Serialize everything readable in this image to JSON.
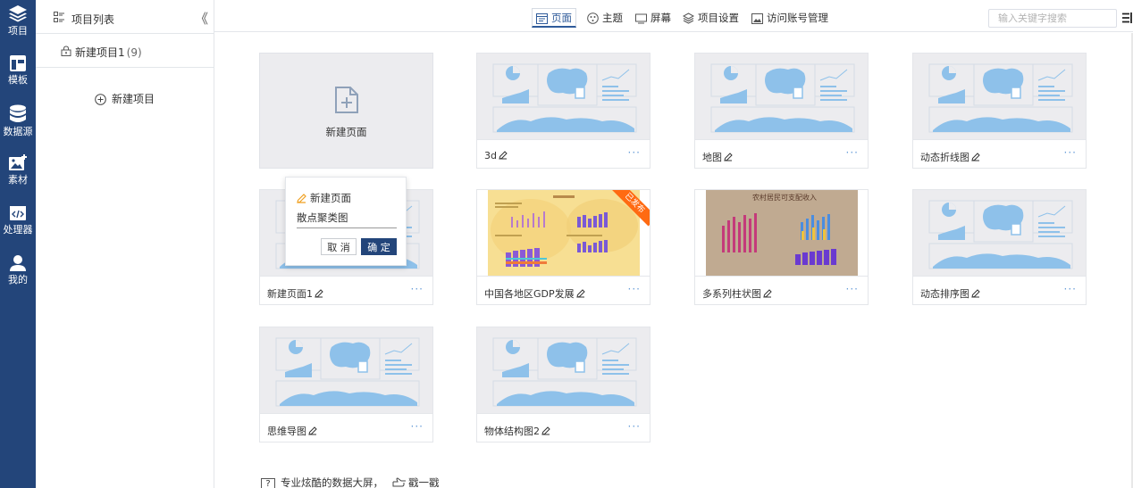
{
  "rail": {
    "items": [
      {
        "label": "项目",
        "icon": "layers-icon"
      },
      {
        "label": "模板",
        "icon": "template-icon"
      },
      {
        "label": "数据源",
        "icon": "database-icon"
      },
      {
        "label": "素材",
        "icon": "image-add-icon"
      },
      {
        "label": "处理器",
        "icon": "code-icon"
      },
      {
        "label": "我的",
        "icon": "user-icon"
      }
    ]
  },
  "panel": {
    "title": "项目列表",
    "collapse": "《",
    "project_name": "新建项目1",
    "project_count": "(9)",
    "new_project": "新建项目"
  },
  "topbar": {
    "tabs": [
      {
        "label": "页面",
        "icon": "page-icon",
        "active": true
      },
      {
        "label": "主题",
        "icon": "theme-icon"
      },
      {
        "label": "屏幕",
        "icon": "screen-icon"
      },
      {
        "label": "项目设置",
        "icon": "settings-layers-icon"
      },
      {
        "label": "访问账号管理",
        "icon": "account-image-icon"
      }
    ],
    "search_placeholder": "输入关键字搜索"
  },
  "cards": {
    "new_page_label": "新建页面",
    "items": [
      {
        "name": "3d",
        "thumb": "default"
      },
      {
        "name": "地图",
        "thumb": "default"
      },
      {
        "name": "动态折线图",
        "thumb": "default"
      },
      {
        "name": "新建页面1",
        "thumb": "default"
      },
      {
        "name": "中国各地区GDP发展",
        "thumb": "yellow",
        "badge": "已发布"
      },
      {
        "name": "多系列柱状图",
        "thumb": "brown",
        "thumb_title": "农村居民可支配收入"
      },
      {
        "name": "动态排序图",
        "thumb": "default"
      },
      {
        "name": "思维导图",
        "thumb": "default"
      },
      {
        "name": "物体结构图2",
        "thumb": "default"
      }
    ],
    "more": "···"
  },
  "popup": {
    "type_label": "新建页面",
    "name_value": "散点聚类图",
    "cancel": "取 消",
    "ok": "确 定"
  },
  "footer": {
    "tip": "专业炫酷的数据大屏，",
    "link": "戳一戳",
    "q": "?"
  },
  "colors": {
    "rail": "#23457a",
    "accent": "#2f5b9a",
    "badge": "#ff6a12",
    "thumb_blue": "#8ec1ea"
  }
}
